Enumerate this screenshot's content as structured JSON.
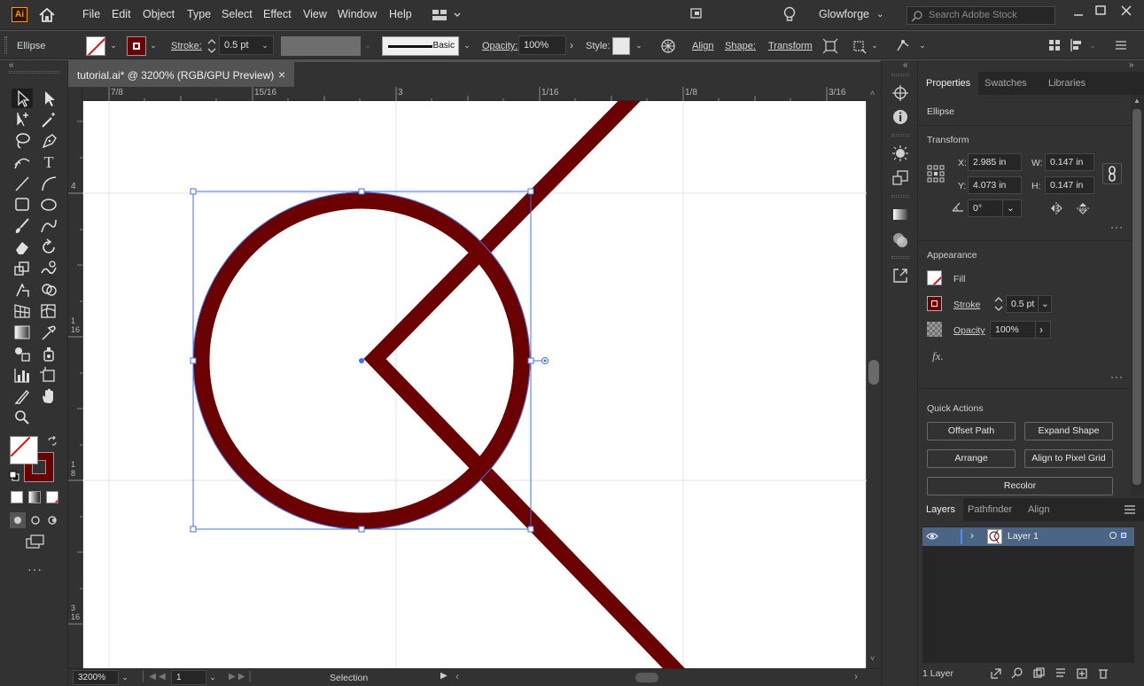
{
  "app": {
    "logo": "Ai"
  },
  "menu": [
    "File",
    "Edit",
    "Object",
    "Type",
    "Select",
    "Effect",
    "View",
    "Window",
    "Help"
  ],
  "workspace": {
    "name": "Glowforge",
    "search_placeholder": "Search Adobe Stock"
  },
  "control": {
    "object_type": "Ellipse",
    "stroke_label": "Stroke:",
    "stroke_value": "0.5 pt",
    "brush": "Basic",
    "opacity_label": "Opacity:",
    "opacity_value": "100%",
    "style_label": "Style:",
    "align_label": "Align",
    "shape_label": "Shape:",
    "transform_label": "Transform"
  },
  "document": {
    "tab_title": "tutorial.ai* @ 3200% (RGB/GPU Preview)",
    "close_glyph": "×"
  },
  "ruler": {
    "top": [
      "7/8",
      "15/16",
      "3",
      "1/16",
      "1/8",
      "3/16"
    ],
    "left": [
      {
        "n": "4",
        "d": ""
      },
      {
        "n": "1",
        "d": "16"
      },
      {
        "n": "1",
        "d": "8"
      },
      {
        "n": "3",
        "d": "16"
      }
    ]
  },
  "status": {
    "zoom": "3200%",
    "page": "1",
    "mode": "Selection"
  },
  "colors": {
    "stroke": "#6b0000",
    "selection": "#3f74e5",
    "ui_dark": "#323232",
    "ui_bg": "#535353"
  },
  "properties": {
    "tabs": [
      "Properties",
      "Swatches",
      "Libraries"
    ],
    "object_type": "Ellipse",
    "transform": {
      "title": "Transform",
      "x_label": "X:",
      "x": "2.985 in",
      "y_label": "Y:",
      "y": "4.073 in",
      "w_label": "W:",
      "w": "0.147 in",
      "h_label": "H:",
      "h": "0.147 in",
      "angle": "0°"
    },
    "appearance": {
      "title": "Appearance",
      "fill_label": "Fill",
      "stroke_label": "Stroke",
      "stroke_value": "0.5 pt",
      "opacity_label": "Opacity",
      "opacity_value": "100%",
      "fx": "fx."
    },
    "quick_actions": {
      "title": "Quick Actions",
      "buttons": [
        "Offset Path",
        "Expand Shape",
        "Arrange",
        "Align to Pixel Grid",
        "Recolor"
      ]
    }
  },
  "layers": {
    "tabs": [
      "Layers",
      "Pathfinder",
      "Align"
    ],
    "items": [
      {
        "name": "Layer 1"
      }
    ],
    "count": "1 Layer"
  }
}
